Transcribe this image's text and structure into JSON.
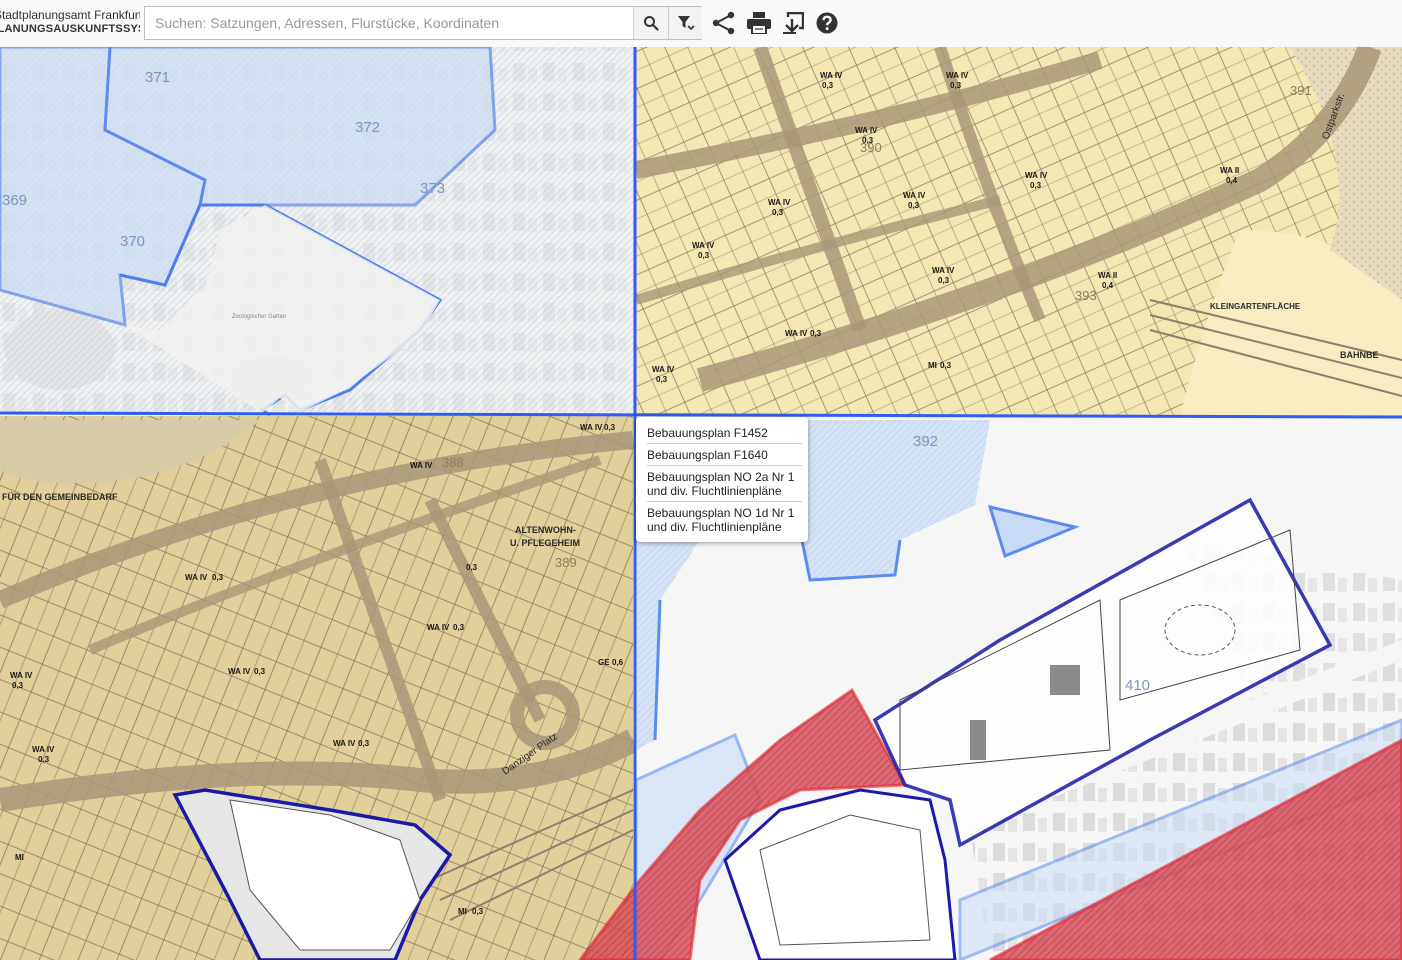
{
  "header": {
    "org_name": "Stadtplanungsamt Frankfurt am Main",
    "system_name": "PLANUNGSAUSKUNFTSSYSTEM"
  },
  "search": {
    "placeholder": "Suchen: Satzungen, Adressen, Flurstücke, Koordinaten",
    "value": ""
  },
  "toolbar": {
    "icons": [
      "search-icon",
      "filter-icon",
      "share-icon",
      "print-icon",
      "export-icon",
      "help-icon"
    ]
  },
  "map": {
    "district_numbers": [
      "371",
      "372",
      "373",
      "369",
      "370",
      "392",
      "410",
      "388",
      "389",
      "390",
      "391",
      "393"
    ],
    "labels": {
      "kleingartenflaeche": "KLEINGARTENFLÄCHE",
      "bahnbe": "BAHNBE",
      "ostparkstr": "Ostparkstr.",
      "altenwohn": "ALTENWOHN-",
      "pflegeheim": "U. PFLEGEHEIM",
      "gemeinbedarf": "FÜR DEN GEMEINBEDARF",
      "zoo": "Zoologischer Garten",
      "danziger_platz": "Danziger Platz"
    },
    "zones": [
      "WA IV",
      "0,3",
      "WA II",
      "0,4",
      "MI",
      "GE",
      "0,6"
    ],
    "colors": {
      "plan_blue_fill": "#c9dcf5",
      "plan_blue_line": "#3366ff",
      "plan_dark_line": "#1a1aa8",
      "plan_red_fill": "#d8505a",
      "plan_red_line": "#e0202e",
      "map_yellow": "#f3e7b2",
      "map_tan": "#e2d09a",
      "street_brown": "#b9a98b"
    }
  },
  "popup": {
    "items": [
      "Bebauungsplan F1452",
      "Bebauungsplan F1640",
      "Bebauungsplan NO 2a Nr 1 und div. Fluchtlinienpläne",
      "Bebauungsplan NO 1d Nr 1 und div. Fluchtlinienpläne"
    ]
  }
}
